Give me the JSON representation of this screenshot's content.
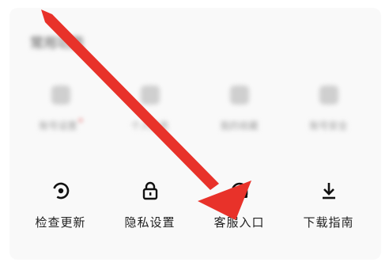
{
  "section": {
    "title": "常用功能"
  },
  "top_items": [
    {
      "label": "账号设置",
      "icon": "person-icon"
    },
    {
      "label": "个人信息",
      "icon": "gift-icon"
    },
    {
      "label": "我的收藏",
      "icon": "folder-icon"
    },
    {
      "label": "账号安全",
      "icon": "shield-icon"
    }
  ],
  "bottom_items": [
    {
      "label": "检查更新",
      "icon": "update-icon"
    },
    {
      "label": "隐私设置",
      "icon": "lock-icon"
    },
    {
      "label": "客服入口",
      "icon": "headphones-icon"
    },
    {
      "label": "下载指南",
      "icon": "download-icon"
    }
  ],
  "colors": {
    "arrow": "#e8322a",
    "background": "#f9f9f9"
  }
}
